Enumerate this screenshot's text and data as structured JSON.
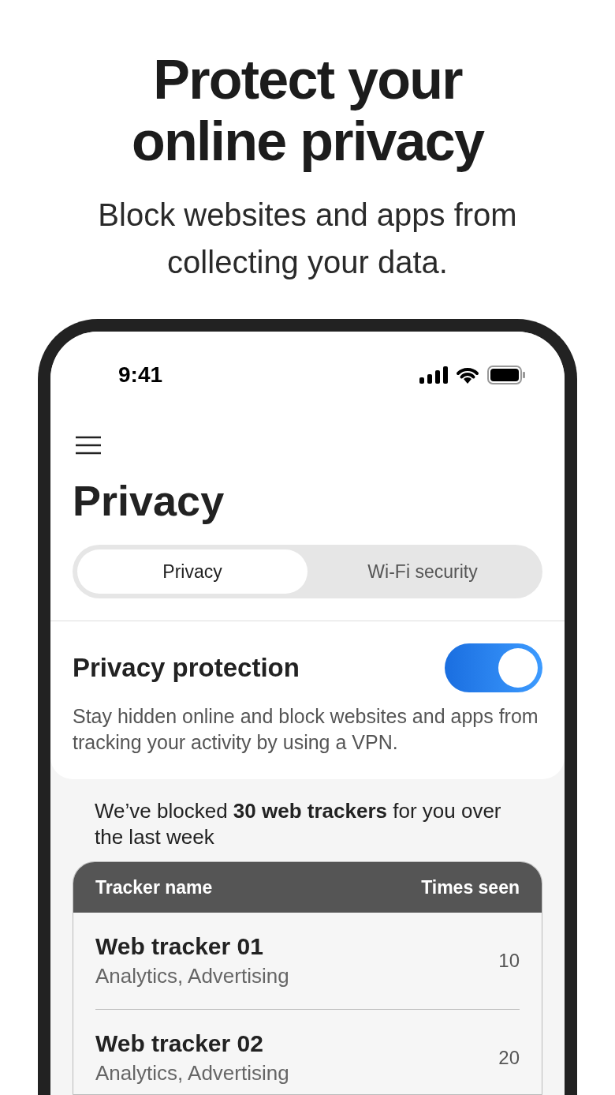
{
  "headline": "Protect your online privacy",
  "subheadline": "Block websites and apps from collecting your data.",
  "phone": {
    "status_bar": {
      "time": "9:41"
    },
    "title": "Privacy",
    "tabs": [
      {
        "label": "Privacy",
        "selected": true
      },
      {
        "label": "Wi-Fi security",
        "selected": false
      }
    ],
    "protection": {
      "title": "Privacy protection",
      "on": true,
      "description": "Stay hidden online and block websites and apps from tracking your activity by using a VPN."
    },
    "summary": "We’ve blocked **30 web trackers** for you over the last week",
    "table": {
      "columns": [
        "Tracker name",
        "Times seen"
      ],
      "rows": [
        {
          "name": "Web tracker 01",
          "categories": "Analytics, Advertising",
          "times_seen": "10"
        },
        {
          "name": "Web tracker 02",
          "categories": "Analytics, Advertising",
          "times_seen": "20"
        }
      ]
    }
  }
}
